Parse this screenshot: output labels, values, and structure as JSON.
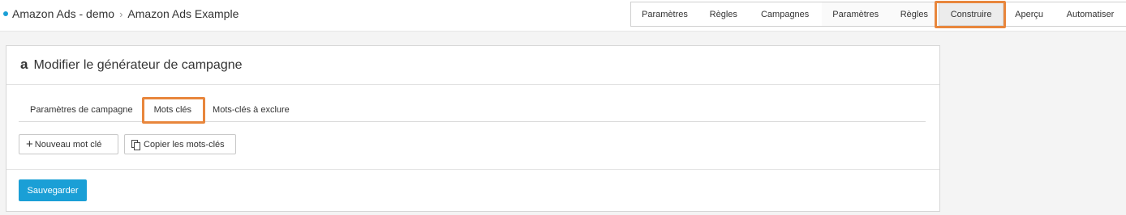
{
  "breadcrumb": {
    "account": "Amazon Ads - demo",
    "page": "Amazon Ads Example"
  },
  "wizard": {
    "steps": [
      "Paramètres",
      "Règles",
      "Campagnes",
      "Paramètres",
      "Règles",
      "Construire",
      "Aperçu",
      "Automatiser"
    ],
    "active": "Construire"
  },
  "panel": {
    "title": "Modifier le générateur de campagne",
    "tabs": [
      "Paramètres de campagne",
      "Mots clés",
      "Mots-clés à exclure"
    ],
    "active_tab": "Mots clés",
    "new_keyword_label": "Nouveau mot clé",
    "copy_keywords_label": "Copier les mots-clés",
    "save_label": "Sauvegarder"
  },
  "colors": {
    "accent": "#1a9fd6",
    "highlight": "#e8863c"
  }
}
